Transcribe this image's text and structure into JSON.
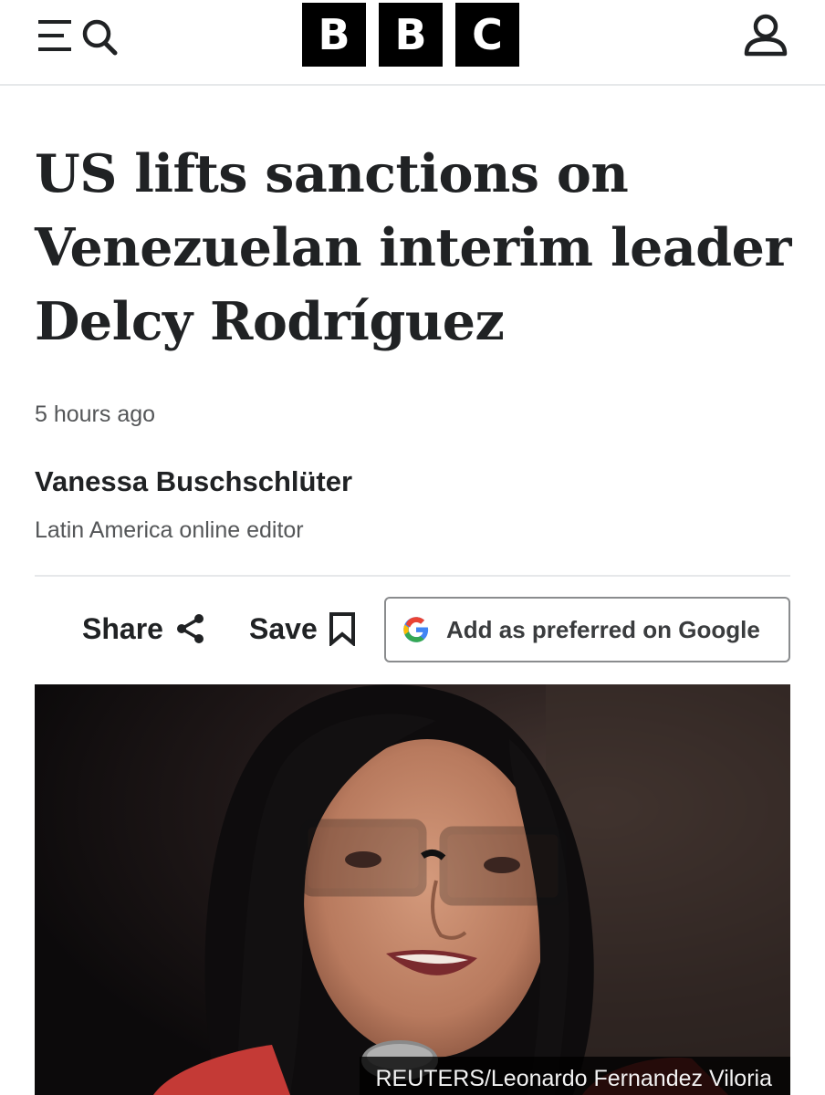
{
  "header": {
    "logo_letters": [
      "B",
      "B",
      "C"
    ],
    "menu_icon": "menu-icon",
    "search_icon": "search-icon",
    "account_icon": "account-icon"
  },
  "article": {
    "headline_lines": [
      "US lifts sanctions on",
      "Venezuelan interim leader",
      "Delcy Rodríguez"
    ],
    "timestamp": "5 hours ago",
    "author": {
      "name": "Vanessa Buschschlüter",
      "role": "Latin America online editor"
    }
  },
  "actions": {
    "share_label": "Share",
    "share_icon": "share-icon",
    "save_label": "Save",
    "save_icon": "bookmark-icon",
    "google_label": "Add as preferred on Google",
    "google_icon": "google-g-icon"
  },
  "image": {
    "caption": "REUTERS/Leonardo Fernandez Viloria"
  },
  "colors": {
    "text": "#202224",
    "muted": "#545658",
    "divider": "#e6e8ea",
    "logo_bg": "#000000"
  }
}
